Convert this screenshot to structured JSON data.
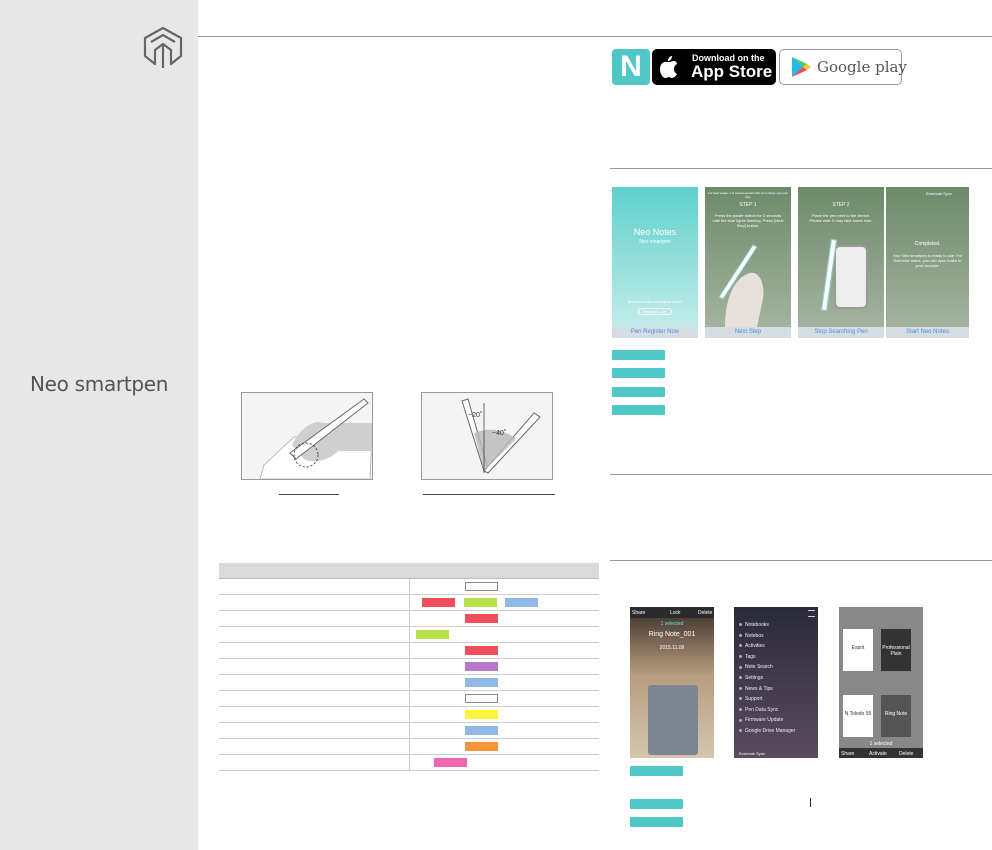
{
  "sidebar": {
    "brand": "Neo smartpen"
  },
  "store_badges": {
    "app_store_small": "Download on the",
    "app_store_big": "App Store",
    "google_play": "Google play",
    "neo_logo_letter": "N"
  },
  "onboarding_screens": [
    {
      "title": "Neo Notes",
      "subtitle": "Neo smartpen",
      "bar": "Pen Register Now",
      "footer_q": "Are you a Neo smartpen user?",
      "footer_btn": "Register Later"
    },
    {
      "title": "STEP 1",
      "note": "For best usage, it is recommended that you charge your pen fully.",
      "text": "Press the power button for 3 seconds until the blue lights flashing. Press [Next Step] button.",
      "bar": "Next Step"
    },
    {
      "title": "STEP 2",
      "text": "Place the pen next to the device. Please wait. It may take some time.",
      "bar": "Stop Searching Pen"
    },
    {
      "title": "Completed.",
      "corner": "Evernote Sync",
      "text": "Your Neo smartpen is ready to use. For Evernote users, you can sync notes to your account.",
      "bar": "Start Neo Notes"
    }
  ],
  "notebook_screens": {
    "screen1": {
      "share": "Share",
      "lock": "Lock",
      "delete": "Delete",
      "selected": "1 selected",
      "note_title": "Ring Note_001",
      "date": "2015.11.09"
    },
    "screen2": {
      "menu": [
        "Notebooks",
        "Notebox",
        "Activities",
        "Tags",
        "Note Search",
        "Settings",
        "News & Tips",
        "Support",
        "Pen Data Sync",
        "Firmware Update",
        "Google Drive Manager"
      ],
      "footer": "Evernote Sync"
    },
    "screen3": {
      "labels": [
        "Esprit",
        "Professional Plain",
        "N Toledo 55",
        "Ring Note"
      ],
      "selected": "1 selected",
      "share": "Share",
      "activate": "Activate",
      "delete": "Delete"
    }
  },
  "color_swatches": [
    [
      "#ffffff"
    ],
    [
      "#f04d5a",
      "#b7e14a",
      "#8fb8e4"
    ],
    [
      "#f04d5a"
    ],
    [
      "#b7e14a"
    ],
    [
      "#f04d5a"
    ],
    [
      "#b779c8"
    ],
    [
      "#8fb8e4"
    ],
    [
      "#ffffff"
    ],
    [
      "#fef33b"
    ],
    [
      "#8fb8e4"
    ],
    [
      "#f7943a"
    ],
    [
      "#ef67b4"
    ]
  ],
  "angles": {
    "a": "~20˚",
    "b": "~40˚"
  },
  "colors": {
    "teal": "#4fc7c6",
    "sidebar": "#e7e7e7",
    "rule": "#9a9a9a"
  }
}
